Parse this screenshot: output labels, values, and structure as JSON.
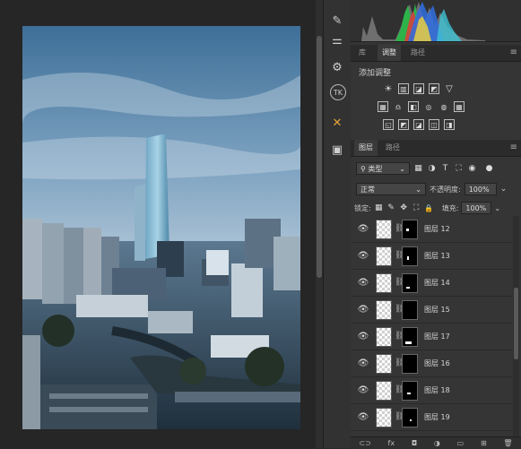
{
  "tools": [
    {
      "icon": "brush-icon",
      "glyph": "✎"
    },
    {
      "icon": "sliders-icon",
      "glyph": "⚌"
    },
    {
      "icon": "properties-icon",
      "glyph": "⚙"
    },
    {
      "icon": "tk-plugin-icon",
      "glyph": "TK"
    },
    {
      "icon": "crossed-tools-icon",
      "glyph": "✕"
    },
    {
      "icon": "panel-icon",
      "glyph": "▣"
    }
  ],
  "panel_tabs_top": [
    {
      "label": "库",
      "active": false
    },
    {
      "label": "调整",
      "active": true
    },
    {
      "label": "路径",
      "active": false
    }
  ],
  "adjustments": {
    "title": "添加调整",
    "row1": [
      "☀",
      "▥",
      "◪",
      "◩",
      "▽"
    ],
    "row2": [
      "▦",
      "♎",
      "◧",
      "◎",
      "◍",
      "▦"
    ],
    "row3": [
      "◱",
      "◩",
      "◪",
      "◫",
      "◨"
    ]
  },
  "layers_tabs": [
    {
      "label": "图层",
      "active": true
    },
    {
      "label": "路径",
      "active": false
    }
  ],
  "filter": {
    "kind_label": "类型",
    "icons": [
      "▦",
      "◑",
      "T",
      "⛶",
      "◉"
    ]
  },
  "blend": {
    "mode": "正常",
    "opacity_label": "不透明度:",
    "opacity_value": "100%"
  },
  "lock": {
    "label": "锁定:",
    "icons": [
      "▦",
      "✎",
      "✥",
      "⛶",
      "🔒"
    ],
    "fill_label": "填充:",
    "fill_value": "100%"
  },
  "layers": [
    {
      "name": "图层 12"
    },
    {
      "name": "图层 13"
    },
    {
      "name": "图层 14"
    },
    {
      "name": "图层 15"
    },
    {
      "name": "图层 17"
    },
    {
      "name": "图层 16"
    },
    {
      "name": "图层 18"
    },
    {
      "name": "图层 19"
    }
  ],
  "bottom_icons": [
    "⊂⊃",
    "fx",
    "◘",
    "◑",
    "▭",
    "⊞",
    "🗑"
  ],
  "colors": {
    "panel_bg": "#353535",
    "canvas_bg": "#262626",
    "accent_orange": "#e8a33a"
  }
}
